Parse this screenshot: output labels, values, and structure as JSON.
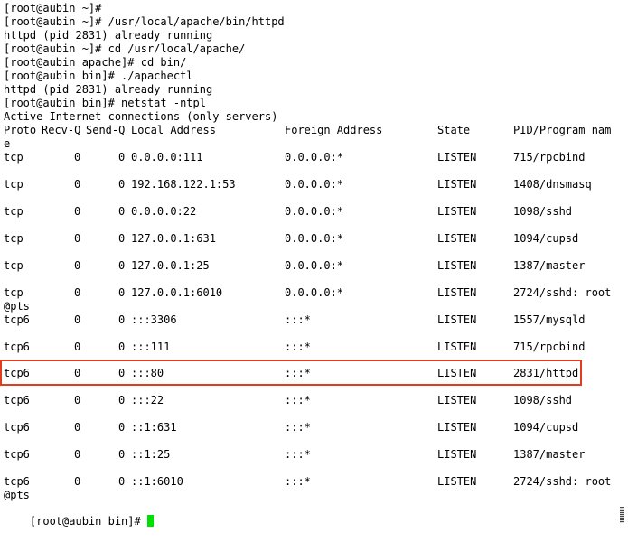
{
  "lines": [
    "[root@aubin ~]#",
    "[root@aubin ~]# /usr/local/apache/bin/httpd",
    "httpd (pid 2831) already running",
    "[root@aubin ~]# cd /usr/local/apache/",
    "[root@aubin apache]# cd bin/",
    "[root@aubin bin]# ./apachectl",
    "httpd (pid 2831) already running",
    "[root@aubin bin]# netstat -ntpl",
    "Active Internet connections (only servers)"
  ],
  "header": {
    "proto": "Proto",
    "recvq": "Recv-Q",
    "sendq": "Send-Q",
    "local": "Local Address",
    "foreign": "Foreign Address",
    "state": "State",
    "pid": "PID/Program nam",
    "wrap": "e"
  },
  "rows": [
    {
      "proto": "tcp",
      "recvq": "0",
      "sendq": "0",
      "local": "0.0.0.0:111",
      "foreign": "0.0.0.0:*",
      "state": "LISTEN",
      "pid": "715/rpcbind"
    },
    {
      "proto": "tcp",
      "recvq": "0",
      "sendq": "0",
      "local": "192.168.122.1:53",
      "foreign": "0.0.0.0:*",
      "state": "LISTEN",
      "pid": "1408/dnsmasq"
    },
    {
      "proto": "tcp",
      "recvq": "0",
      "sendq": "0",
      "local": "0.0.0.0:22",
      "foreign": "0.0.0.0:*",
      "state": "LISTEN",
      "pid": "1098/sshd"
    },
    {
      "proto": "tcp",
      "recvq": "0",
      "sendq": "0",
      "local": "127.0.0.1:631",
      "foreign": "0.0.0.0:*",
      "state": "LISTEN",
      "pid": "1094/cupsd"
    },
    {
      "proto": "tcp",
      "recvq": "0",
      "sendq": "0",
      "local": "127.0.0.1:25",
      "foreign": "0.0.0.0:*",
      "state": "LISTEN",
      "pid": "1387/master"
    },
    {
      "proto": "tcp",
      "recvq": "0",
      "sendq": "0",
      "local": "127.0.0.1:6010",
      "foreign": "0.0.0.0:*",
      "state": "LISTEN",
      "pid": "2724/sshd: root",
      "wrap": "@pts"
    },
    {
      "proto": "tcp6",
      "recvq": "0",
      "sendq": "0",
      "local": ":::3306",
      "foreign": ":::*",
      "state": "LISTEN",
      "pid": "1557/mysqld"
    },
    {
      "proto": "tcp6",
      "recvq": "0",
      "sendq": "0",
      "local": ":::111",
      "foreign": ":::*",
      "state": "LISTEN",
      "pid": "715/rpcbind"
    },
    {
      "proto": "tcp6",
      "recvq": "0",
      "sendq": "0",
      "local": ":::80",
      "foreign": ":::*",
      "state": "LISTEN",
      "pid": "2831/httpd"
    },
    {
      "proto": "tcp6",
      "recvq": "0",
      "sendq": "0",
      "local": ":::22",
      "foreign": ":::*",
      "state": "LISTEN",
      "pid": "1098/sshd"
    },
    {
      "proto": "tcp6",
      "recvq": "0",
      "sendq": "0",
      "local": "::1:631",
      "foreign": ":::*",
      "state": "LISTEN",
      "pid": "1094/cupsd"
    },
    {
      "proto": "tcp6",
      "recvq": "0",
      "sendq": "0",
      "local": "::1:25",
      "foreign": ":::*",
      "state": "LISTEN",
      "pid": "1387/master"
    },
    {
      "proto": "tcp6",
      "recvq": "0",
      "sendq": "0",
      "local": "::1:6010",
      "foreign": ":::*",
      "state": "LISTEN",
      "pid": "2724/sshd: root",
      "wrap": "@pts"
    }
  ],
  "prompt": "[root@aubin bin]# ",
  "colors": {
    "highlight_border": "#e03c1e",
    "cursor": "#00e000"
  }
}
